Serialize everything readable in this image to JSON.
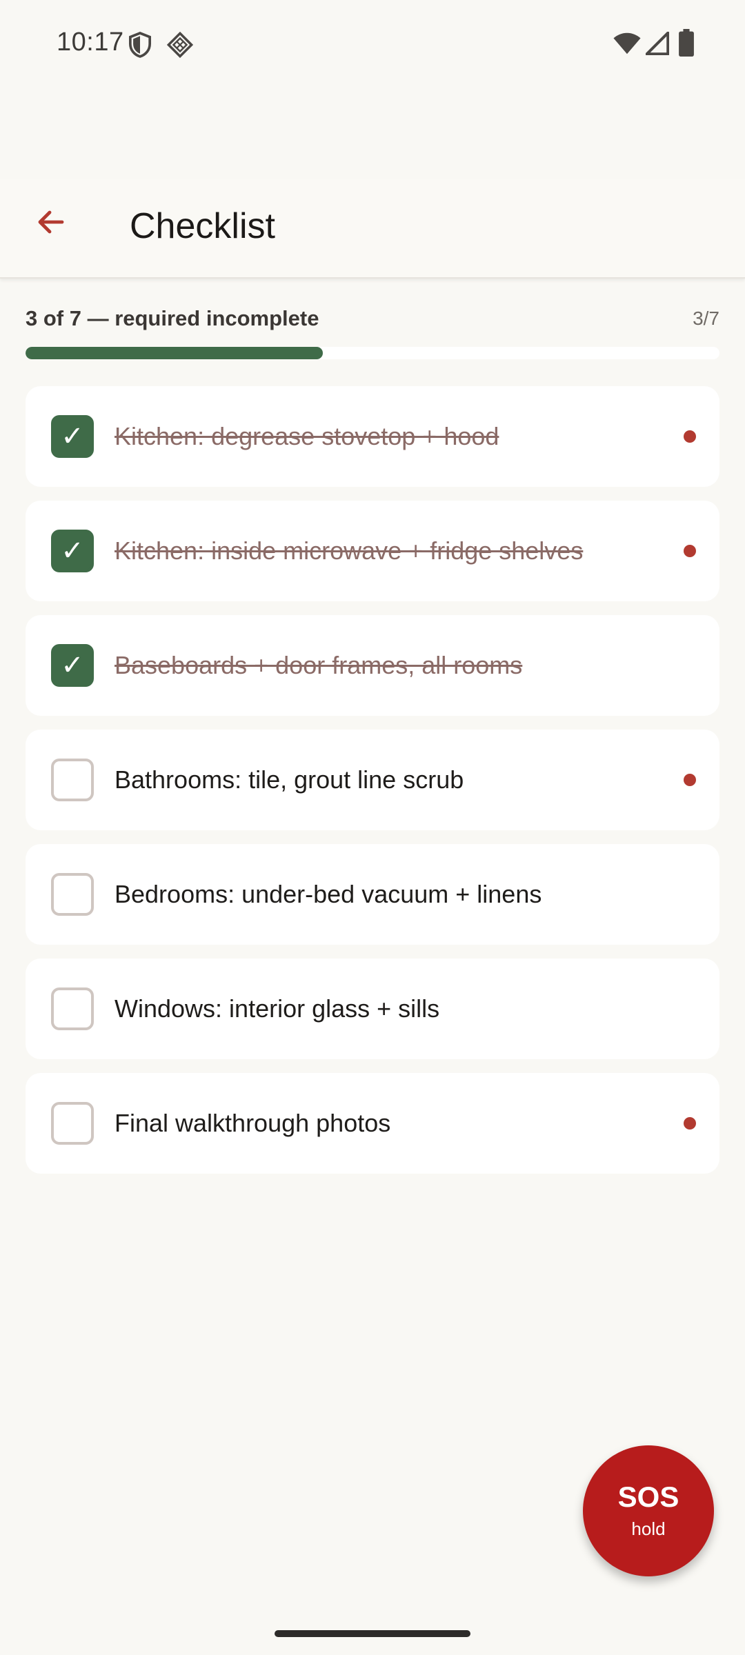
{
  "status_bar": {
    "time": "10:17",
    "left_icons": [
      "shield-icon",
      "vpn-key-icon"
    ],
    "right_icons": [
      "wifi-icon",
      "cell-signal-icon",
      "battery-icon"
    ]
  },
  "app_bar": {
    "back_icon": "arrow-back-icon",
    "title": "Checklist",
    "accent_color": "#b23a30"
  },
  "progress": {
    "label": "3 of 7 — required incomplete",
    "count": "3/7",
    "completed": 3,
    "total": 7,
    "fraction": 0.4286,
    "color": "#3f6b48"
  },
  "tasks": [
    {
      "label": "Kitchen: degrease stovetop + hood",
      "done": true,
      "required": true
    },
    {
      "label": "Kitchen: inside microwave + fridge shelves",
      "done": true,
      "required": true
    },
    {
      "label": "Baseboards + door frames, all rooms",
      "done": true,
      "required": false
    },
    {
      "label": "Bathrooms: tile, grout line scrub",
      "done": false,
      "required": true
    },
    {
      "label": "Bedrooms: under-bed vacuum + linens",
      "done": false,
      "required": false
    },
    {
      "label": "Windows: interior glass + sills",
      "done": false,
      "required": false
    },
    {
      "label": "Final walkthrough photos",
      "done": false,
      "required": true
    }
  ],
  "check_glyph": "✓",
  "sos": {
    "label": "SOS",
    "sublabel": "hold",
    "color": "#b71c1c"
  }
}
